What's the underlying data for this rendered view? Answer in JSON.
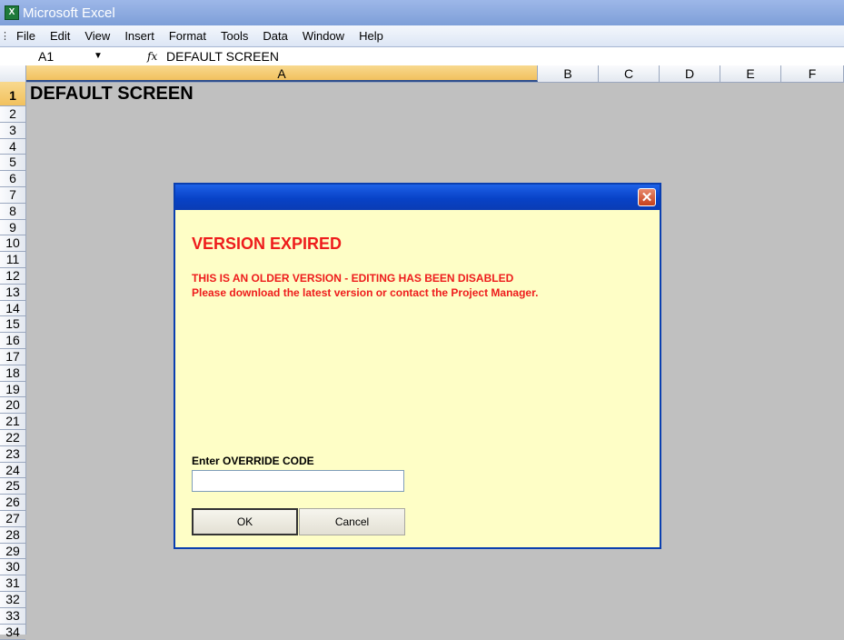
{
  "window": {
    "title": "Microsoft Excel"
  },
  "menu": [
    "File",
    "Edit",
    "View",
    "Insert",
    "Format",
    "Tools",
    "Data",
    "Window",
    "Help"
  ],
  "formula_bar": {
    "name_box": "A1",
    "fx_label": "fx",
    "content": "DEFAULT SCREEN"
  },
  "columns": [
    "A",
    "B",
    "C",
    "D",
    "E",
    "F"
  ],
  "rows": [
    "1",
    "2",
    "3",
    "4",
    "5",
    "6",
    "7",
    "8",
    "9",
    "10",
    "11",
    "12",
    "13",
    "14",
    "15",
    "16",
    "17",
    "18",
    "19",
    "20",
    "21",
    "22",
    "23",
    "24",
    "25",
    "26",
    "27",
    "28",
    "29",
    "30",
    "31",
    "32",
    "33",
    "34"
  ],
  "sheet": {
    "a1": "DEFAULT SCREEN"
  },
  "dialog": {
    "heading": "VERSION EXPIRED",
    "message_line1": "THIS IS AN OLDER VERSION - EDITING HAS BEEN DISABLED",
    "message_line2": "Please download the latest version or contact the Project Manager.",
    "override_label": "Enter OVERRIDE CODE",
    "override_value": "",
    "ok_label": "OK",
    "cancel_label": "Cancel",
    "close_glyph": "✕"
  },
  "colors": {
    "dialog_background": "#fefec6",
    "message_red": "#ee1c1c",
    "dialog_titlebar": "#0842c7",
    "sheet_background": "#c0c0c0"
  },
  "icons": {
    "app": "excel-icon",
    "close": "close-icon",
    "function": "fx-icon",
    "dropdown": "chevron-down-icon"
  }
}
